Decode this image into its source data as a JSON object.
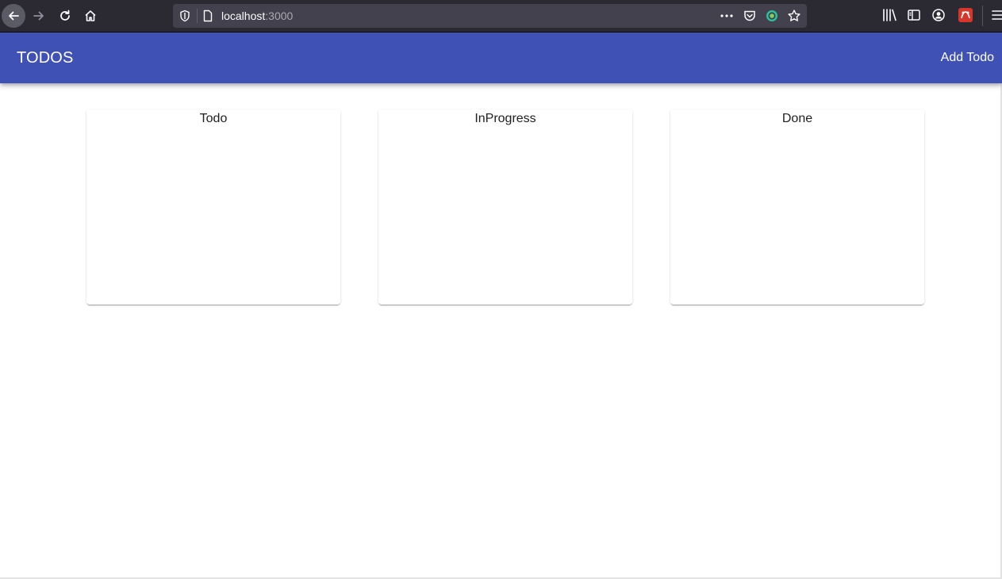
{
  "browser": {
    "url_host": "localhost",
    "url_port": ":3000",
    "icons": [
      "back-icon",
      "forward-icon",
      "reload-icon",
      "home-icon",
      "shield-icon",
      "page-icon",
      "more-icon",
      "pocket-icon",
      "extension-icon",
      "bookmark-star-icon",
      "library-icon",
      "sidebar-icon",
      "account-icon",
      "extension-red-icon",
      "menu-icon"
    ]
  },
  "appbar": {
    "title": "TODOS",
    "action_label": "Add Todo",
    "color": "#3f51b5"
  },
  "board": {
    "columns": [
      {
        "title": "Todo",
        "items": []
      },
      {
        "title": "InProgress",
        "items": []
      },
      {
        "title": "Done",
        "items": []
      }
    ]
  }
}
